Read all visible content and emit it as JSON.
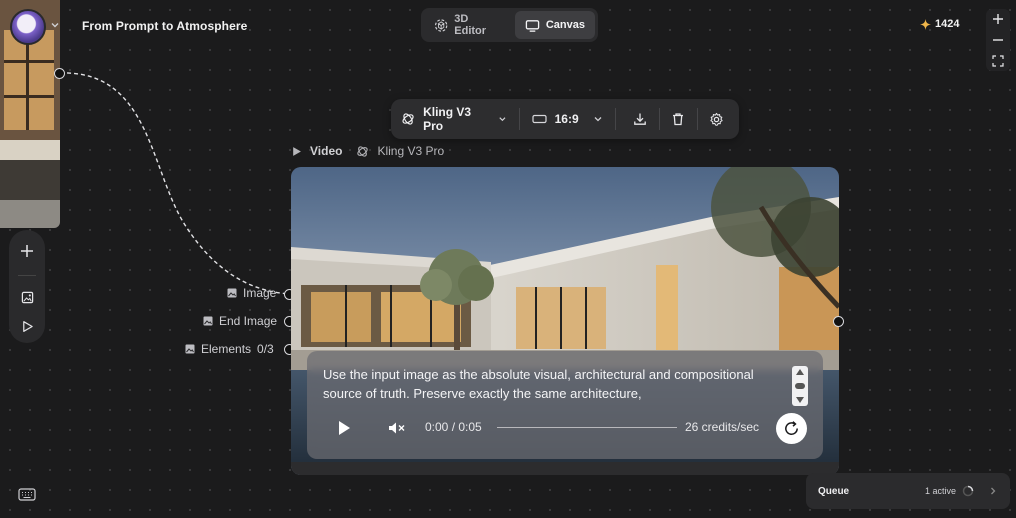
{
  "app": {
    "title": "From Prompt to Atmosphere",
    "credits": "1424"
  },
  "mode_switch": {
    "tabs": [
      {
        "label": "3D Editor",
        "icon": "3d-cube-icon",
        "active": false
      },
      {
        "label": "Canvas",
        "icon": "monitor-icon",
        "active": true
      }
    ]
  },
  "node_toolbar": {
    "model": "Kling V3 Pro",
    "aspect_ratio": "16:9"
  },
  "node": {
    "type_label": "Video",
    "model_label": "Kling V3 Pro",
    "inputs": [
      {
        "label": "Image"
      },
      {
        "label": "End Image"
      },
      {
        "label": "Elements",
        "count": "0/3"
      }
    ],
    "prompt": "Use the input image as the absolute visual, architectural and compositional source of truth. Preserve exactly the same architecture,",
    "player": {
      "time": "0:00 / 0:05",
      "rate": "26 credits/sec",
      "progress": 0
    }
  },
  "queue": {
    "title": "Queue",
    "status": "1 active"
  },
  "colors": {
    "canvas_bg": "#1b1b1c",
    "panel": "#2b2b2d",
    "accent_credit": "#f0b64a"
  }
}
